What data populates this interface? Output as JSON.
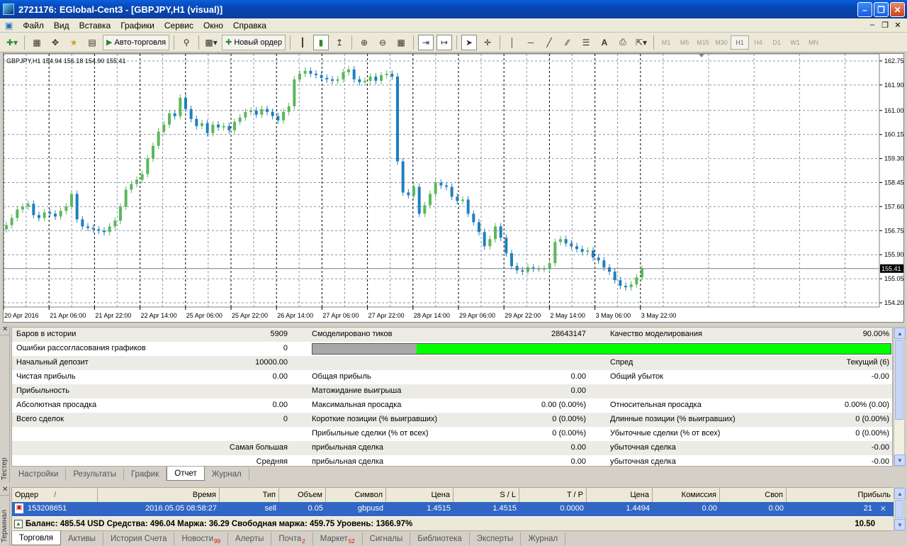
{
  "window": {
    "title": "2721176: EGlobal-Cent3 - [GBPJPY,H1 (visual)]"
  },
  "menu": [
    "Файл",
    "Вид",
    "Вставка",
    "Графики",
    "Сервис",
    "Окно",
    "Справка"
  ],
  "toolbar": {
    "auto_trading": "Авто-торговля",
    "new_order": "Новый ордер",
    "timeframes": [
      "M1",
      "M5",
      "M15",
      "M30",
      "H1",
      "H4",
      "D1",
      "W1",
      "MN"
    ],
    "active_timeframe": "H1"
  },
  "chart": {
    "label": "GBPJPY,H1  154.94 156.18 154.90 155.41",
    "current_price": "155.41",
    "y_ticks": [
      "162.75",
      "161.90",
      "161.00",
      "160.15",
      "159.30",
      "158.45",
      "157.60",
      "156.75",
      "155.90",
      "155.05",
      "154.20"
    ],
    "x_ticks": [
      "20 Apr 2016",
      "21 Apr 06:00",
      "21 Apr 22:00",
      "22 Apr 14:00",
      "25 Apr 06:00",
      "25 Apr 22:00",
      "26 Apr 14:00",
      "27 Apr 06:00",
      "27 Apr 22:00",
      "28 Apr 14:00",
      "29 Apr 06:00",
      "29 Apr 22:00",
      "2 May 14:00",
      "3 May 06:00",
      "3 May 22:00"
    ],
    "colors": {
      "up": "#5cb85c",
      "down": "#1f7fc0",
      "bg": "#ffffff",
      "grid": "#7f8fa0"
    }
  },
  "chart_data": {
    "type": "candlestick",
    "symbol": "GBPJPY",
    "timeframe": "H1",
    "ylim": [
      154.05,
      163.0
    ],
    "close": [
      156.95,
      157.2,
      157.5,
      157.6,
      157.7,
      157.3,
      157.2,
      157.4,
      157.35,
      157.25,
      157.45,
      157.6,
      158.05,
      157.15,
      156.9,
      156.85,
      156.8,
      156.75,
      156.7,
      156.9,
      157.1,
      157.6,
      158.2,
      158.4,
      158.55,
      158.75,
      159.3,
      159.75,
      160.25,
      160.5,
      160.9,
      160.8,
      161.45,
      161.05,
      160.7,
      160.45,
      160.55,
      160.2,
      160.5,
      160.4,
      160.45,
      160.3,
      160.6,
      160.75,
      160.95,
      161.0,
      160.85,
      161.05,
      160.95,
      160.8,
      160.65,
      160.95,
      161.15,
      162.1,
      162.3,
      162.4,
      162.3,
      162.25,
      162.15,
      162.1,
      162.05,
      162.1,
      162.35,
      162.45,
      162.1,
      162.0,
      162.05,
      162.2,
      162.05,
      162.25,
      162.3,
      162.2,
      159.2,
      158.1,
      158.0,
      158.3,
      157.35,
      157.65,
      158.05,
      158.45,
      158.35,
      158.3,
      157.95,
      157.8,
      157.85,
      157.35,
      157.05,
      156.7,
      156.2,
      156.45,
      156.9,
      156.5,
      155.95,
      155.5,
      155.35,
      155.3,
      155.45,
      155.4,
      155.4,
      155.4,
      155.6,
      156.35,
      156.45,
      156.3,
      156.2,
      156.1,
      156.0,
      156.05,
      155.8,
      155.7,
      155.45,
      155.3,
      155.0,
      154.8,
      154.75,
      154.85,
      155.1,
      155.41
    ]
  },
  "tester": {
    "vertical_label": "Тестер",
    "rows": [
      {
        "c1l": "Баров в истории",
        "c1v": "5909",
        "c2l": "Смоделировано тиков",
        "c2v": "28643147",
        "c3l": "Качество моделирования",
        "c3v": "90.00%"
      },
      {
        "c1l": "Ошибки рассогласования графиков",
        "c1v": "0",
        "c2l": "",
        "c2v": "",
        "c3l": "",
        "c3v": ""
      },
      {
        "c1l": "Начальный депозит",
        "c1v": "10000.00",
        "c2l": "",
        "c2v": "",
        "c3l": "Спред",
        "c3v": "Текущий (6)"
      },
      {
        "c1l": "Чистая прибыль",
        "c1v": "0.00",
        "c2l": "Общая прибыль",
        "c2v": "0.00",
        "c3l": "Общий убыток",
        "c3v": "-0.00"
      },
      {
        "c1l": "Прибыльность",
        "c1v": "",
        "c2l": "Матожидание выигрыша",
        "c2v": "0.00",
        "c3l": "",
        "c3v": ""
      },
      {
        "c1l": "Абсолютная просадка",
        "c1v": "0.00",
        "c2l": "Максимальная просадка",
        "c2v": "0.00 (0.00%)",
        "c3l": "Относительная просадка",
        "c3v": "0.00% (0.00)"
      },
      {
        "c1l": "Всего сделок",
        "c1v": "0",
        "c2l": "Короткие позиции (% выигравших)",
        "c2v": "0 (0.00%)",
        "c3l": "Длинные позиции (% выигравших)",
        "c3v": "0 (0.00%)"
      },
      {
        "c1l": "",
        "c1v": "",
        "c2l": "Прибыльные сделки (% от всех)",
        "c2v": "0 (0.00%)",
        "c3l": "Убыточные сделки (% от всех)",
        "c3v": "0 (0.00%)"
      },
      {
        "c1l": "",
        "c1v": "Самая большая",
        "c2l": "прибыльная сделка",
        "c2v": "0.00",
        "c3l": "убыточная сделка",
        "c3v": "-0.00"
      },
      {
        "c1l": "",
        "c1v": "Средняя",
        "c2l": "прибыльная сделка",
        "c2v": "0.00",
        "c3l": "убыточная сделка",
        "c3v": "-0.00"
      }
    ],
    "quality_fraction": 0.18,
    "tabs": [
      "Настройки",
      "Результаты",
      "График",
      "Отчет",
      "Журнал"
    ],
    "active_tab": "Отчет"
  },
  "terminal": {
    "vertical_label": "Терминал",
    "headers": [
      "Ордер",
      "/",
      "Время",
      "Тип",
      "Объем",
      "Символ",
      "Цена",
      "S / L",
      "T / P",
      "Цена",
      "Комиссия",
      "Своп",
      "Прибыль"
    ],
    "order": {
      "id": "153208651",
      "time": "2016.05.05 08:58:27",
      "type": "sell",
      "volume": "0.05",
      "symbol": "gbpusd",
      "price": "1.4515",
      "sl": "1.4515",
      "tp": "0.0000",
      "cur_price": "1.4494",
      "commission": "0.00",
      "swap": "0.00",
      "profit": "21"
    },
    "balance_line": "Баланс: 485.54 USD  Средства: 496.04  Маржа: 36.29  Свободная маржа: 459.75  Уровень: 1366.97%",
    "balance_total": "10.50",
    "tabs": [
      {
        "label": "Торговля",
        "badge": ""
      },
      {
        "label": "Активы",
        "badge": ""
      },
      {
        "label": "История Счета",
        "badge": ""
      },
      {
        "label": "Новости",
        "badge": "99"
      },
      {
        "label": "Алерты",
        "badge": ""
      },
      {
        "label": "Почта",
        "badge": "2"
      },
      {
        "label": "Маркет",
        "badge": "52"
      },
      {
        "label": "Сигналы",
        "badge": ""
      },
      {
        "label": "Библиотека",
        "badge": ""
      },
      {
        "label": "Эксперты",
        "badge": ""
      },
      {
        "label": "Журнал",
        "badge": ""
      }
    ],
    "active_tab": "Торговля"
  }
}
